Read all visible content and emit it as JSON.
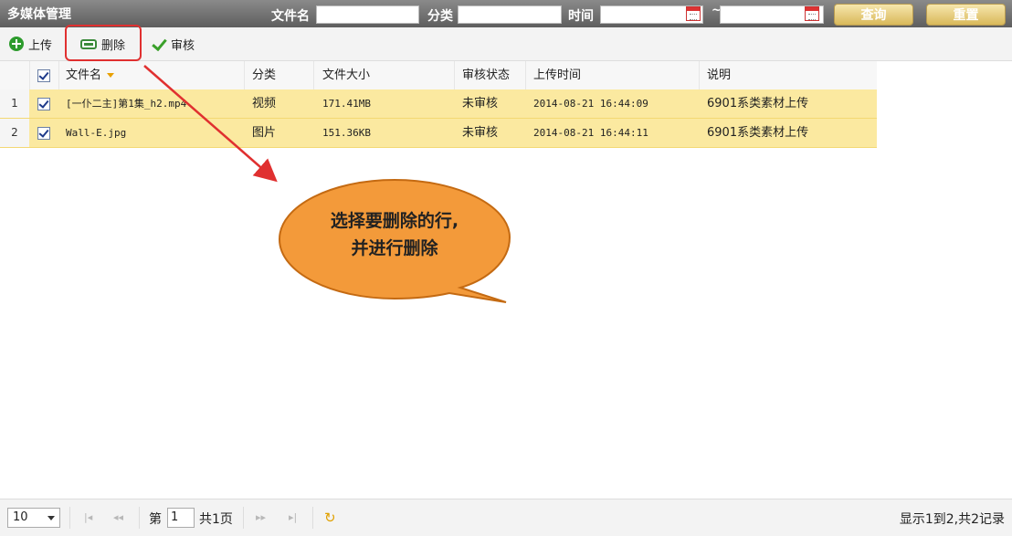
{
  "window": {
    "title": "多媒体管理"
  },
  "search": {
    "filename_label": "文件名",
    "category_label": "分类",
    "time_label": "时间",
    "time_separator": "~",
    "query_button": "查询",
    "reset_button": "重置"
  },
  "toolbar": {
    "upload_label": "上传",
    "delete_label": "删除",
    "review_label": "审核"
  },
  "table": {
    "columns": [
      "文件名",
      "分类",
      "文件大小",
      "审核状态",
      "上传时间",
      "说明"
    ],
    "rows": [
      {
        "num": "1",
        "filename": "[一仆二主]第1集_h2.mp4",
        "category": "视频",
        "size": "171.41MB",
        "status": "未审核",
        "upload_time": "2014-08-21 16:44:09",
        "description": "6901系类素材上传"
      },
      {
        "num": "2",
        "filename": "Wall-E.jpg",
        "category": "图片",
        "size": "151.36KB",
        "status": "未审核",
        "upload_time": "2014-08-21 16:44:11",
        "description": "6901系类素材上传"
      }
    ]
  },
  "annotation": {
    "line1": "选择要删除的行,",
    "line2": "并进行删除",
    "bubble_color": "#f39a3a",
    "arrow_color": "#e03030"
  },
  "pager": {
    "page_size": "10",
    "page_prefix": "第",
    "current_page": "1",
    "page_suffix": "共1页",
    "record_info": "显示1到2,共2记录"
  }
}
